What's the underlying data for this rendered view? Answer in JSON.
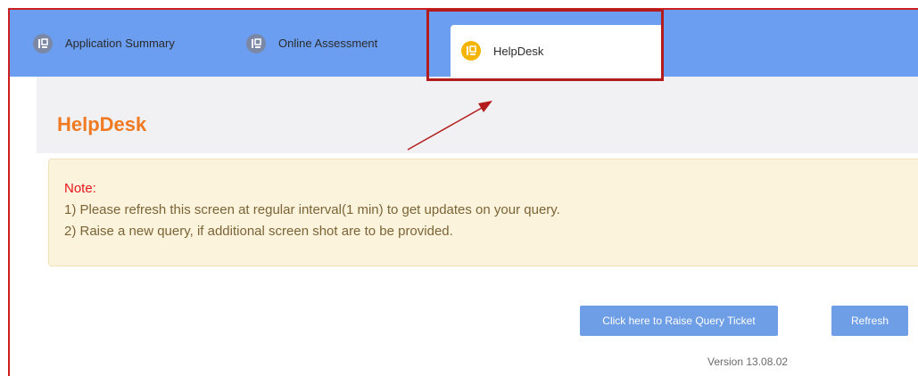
{
  "tabs": [
    {
      "label": "Application Summary",
      "icon": "document-icon",
      "active": false
    },
    {
      "label": "Online Assessment",
      "icon": "document-icon",
      "active": false
    },
    {
      "label": "HelpDesk",
      "icon": "document-icon",
      "active": true
    }
  ],
  "page": {
    "title": "HelpDesk"
  },
  "note": {
    "title": "Note:",
    "lines": [
      "1) Please refresh this screen at regular interval(1 min) to get updates on your query.",
      "2) Raise a new query, if additional screen shot are to be provided."
    ]
  },
  "buttons": {
    "raise_label": "Click here to Raise Query Ticket",
    "refresh_label": "Refresh"
  },
  "footer": {
    "version": "Version 13.08.02"
  },
  "colors": {
    "tabbar": "#6b9ef0",
    "active_icon": "#f4b400",
    "title": "#f07a22",
    "note_title": "#e8141a",
    "annotation": "#b31c1c"
  }
}
